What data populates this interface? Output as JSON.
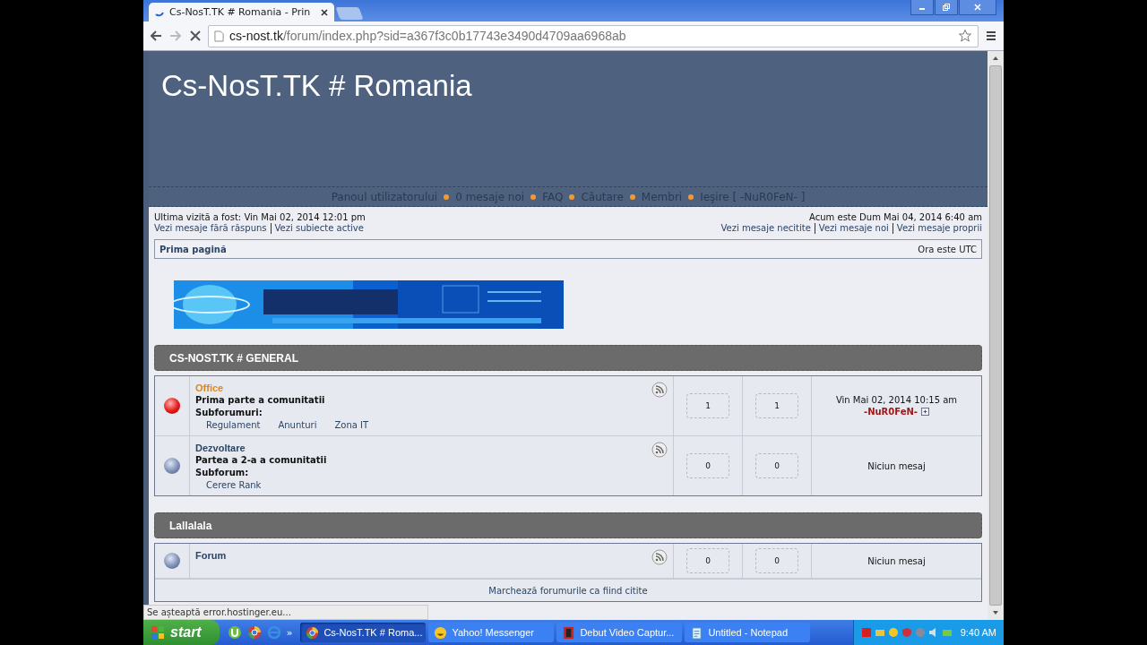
{
  "browser": {
    "tab_title": "Cs-NosT.TK # Romania - Prin",
    "url_host": "cs-nost.tk",
    "url_path": "/forum/index.php?sid=a367f3c0b17743e3490d4709aa6968ab",
    "status": "Se așteaptă error.hostinger.eu..."
  },
  "site_title": "Cs-NosT.TK # Romania",
  "nav": [
    {
      "label": "Panoul utilizatorului"
    },
    {
      "label": "0 mesaje noi"
    },
    {
      "label": "FAQ"
    },
    {
      "label": "Căutare"
    },
    {
      "label": "Membri"
    },
    {
      "label": "Ieşire [ -NuR0FeN- ]"
    }
  ],
  "last_visit": "Ultima vizită a fost: Vin Mai 02, 2014 12:01 pm",
  "links_left": [
    "Vezi mesaje fără răspuns",
    "Vezi subiecte active"
  ],
  "current_time": "Acum este Dum Mai 04, 2014 6:40 am",
  "links_right": [
    "Vezi mesaje necitite",
    "Vezi mesaje noi",
    "Vezi mesaje proprii"
  ],
  "breadcrumb": "Prima pagină",
  "timezone": "Ora este UTC",
  "banner": {
    "kind": "picture"
  },
  "categories": [
    {
      "title": "CS-NOST.TK # GENERAL",
      "forums": [
        {
          "name": "Office",
          "color": "#e0861c",
          "unread": true,
          "description": "Prima parte a comunitatii",
          "subforums_label": "Subforumuri:",
          "subforums": [
            "Regulament",
            "Anunturi",
            "Zona IT"
          ],
          "topics": "1",
          "posts": "1",
          "last_post": "Vin Mai 02, 2014 10:15 am",
          "last_author": "-NuR0FeN-"
        },
        {
          "name": "Dezvoltare",
          "color": "#2d4565",
          "unread": false,
          "description": "Partea a 2-a a comunitatii",
          "subforums_label": "Subforum:",
          "subforums": [
            "Cerere Rank"
          ],
          "topics": "0",
          "posts": "0",
          "no_posts": "Niciun mesaj"
        }
      ]
    },
    {
      "title": "Lallalala",
      "forums": [
        {
          "name": "Forum",
          "color": "#2d4565",
          "unread": false,
          "topics": "0",
          "posts": "0",
          "no_posts": "Niciun mesaj"
        }
      ]
    }
  ],
  "mark_read": "Marchează forumurile ca fiind citite",
  "taskbar": {
    "start": "start",
    "more": "»",
    "tasks": [
      {
        "label": "Cs-NosT.TK # Roma...",
        "selected": true
      },
      {
        "label": "Yahoo! Messenger",
        "selected": false
      },
      {
        "label": "Debut Video Captur...",
        "selected": false
      },
      {
        "label": "Untitled - Notepad",
        "selected": false
      }
    ],
    "clock": "9:40 AM"
  }
}
